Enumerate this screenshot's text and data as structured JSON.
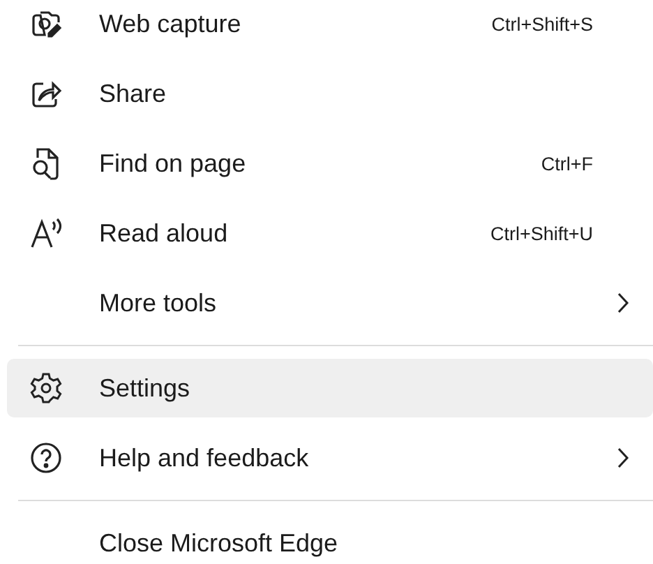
{
  "menu": {
    "sections": [
      {
        "items": [
          {
            "label": "Web capture",
            "shortcut": "Ctrl+Shift+S",
            "has_submenu": false,
            "selected": false
          },
          {
            "label": "Share",
            "has_submenu": false,
            "selected": false
          },
          {
            "label": "Find on page",
            "shortcut": "Ctrl+F",
            "has_submenu": false,
            "selected": false
          },
          {
            "label": "Read aloud",
            "shortcut": "Ctrl+Shift+U",
            "has_submenu": false,
            "selected": false
          },
          {
            "label": "More tools",
            "has_submenu": true,
            "selected": false
          }
        ]
      },
      {
        "items": [
          {
            "label": "Settings",
            "has_submenu": false,
            "selected": true
          },
          {
            "label": "Help and feedback",
            "has_submenu": true,
            "selected": false
          }
        ]
      },
      {
        "items": [
          {
            "label": "Close Microsoft Edge",
            "has_submenu": false,
            "selected": false
          }
        ]
      }
    ]
  }
}
